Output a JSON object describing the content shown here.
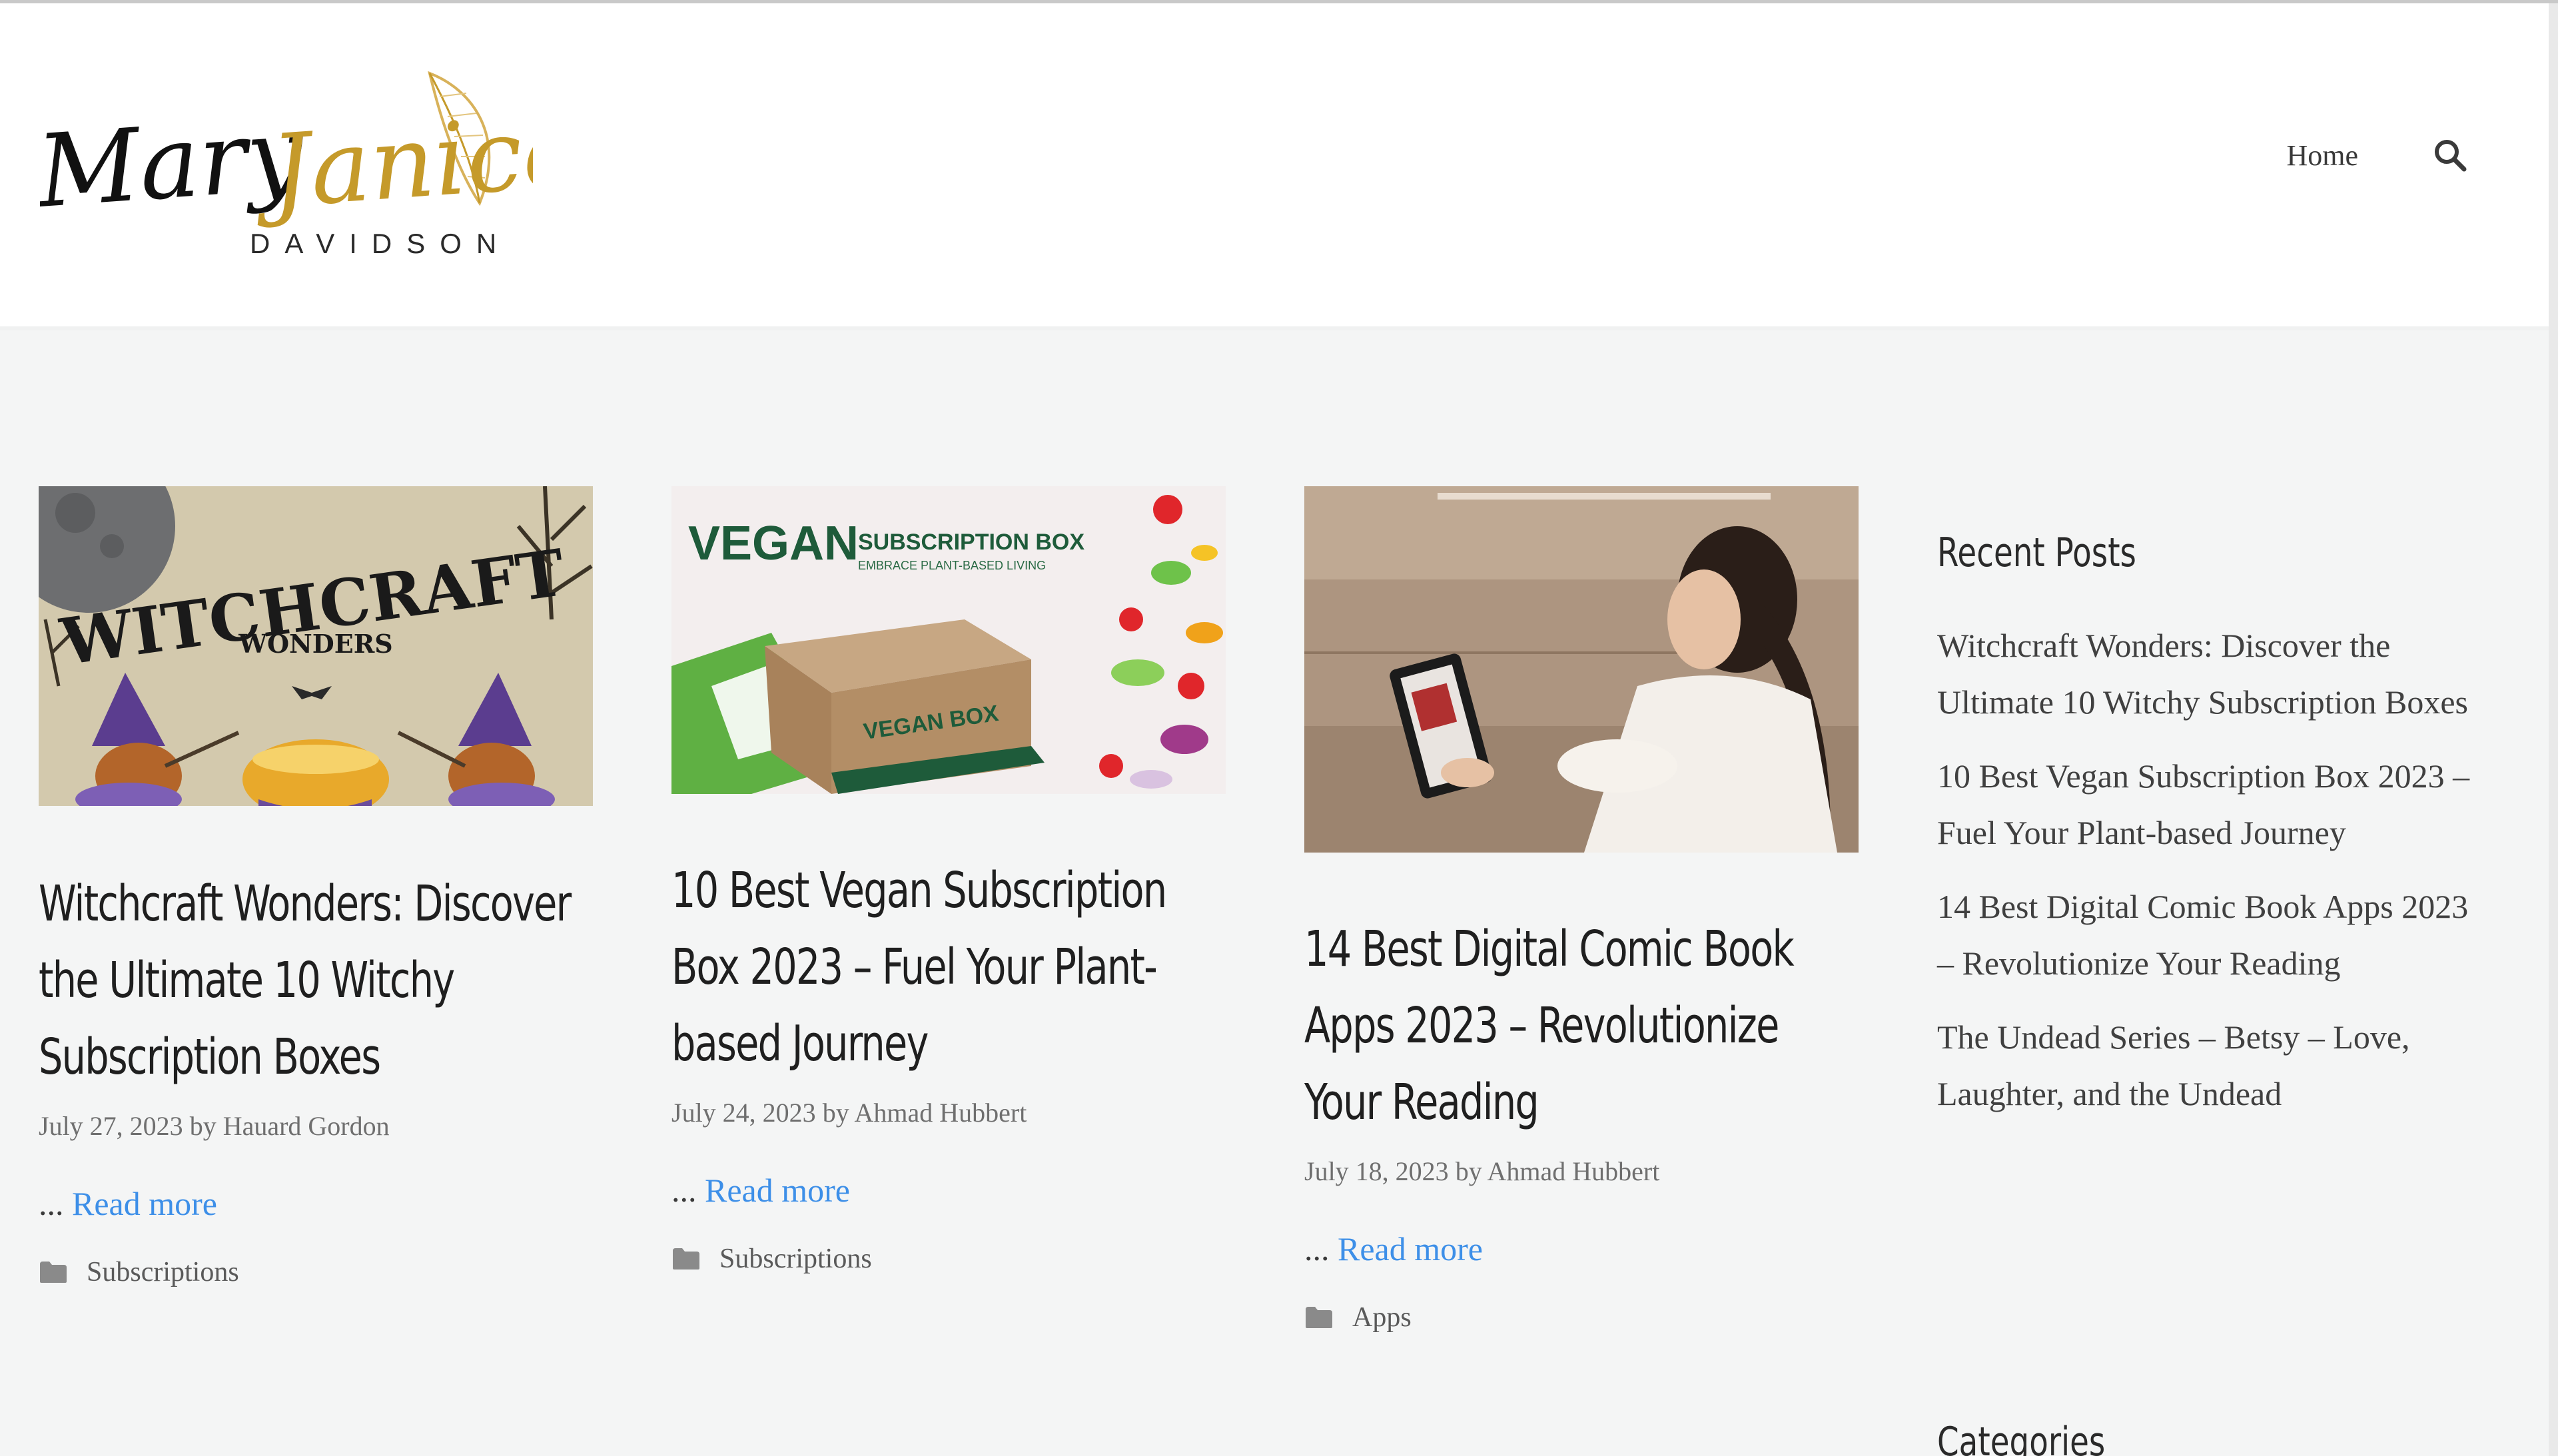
{
  "header": {
    "logo": {
      "first_name": "Mary",
      "middle_name": "Janice",
      "last_name": "DAVIDSON"
    },
    "nav": {
      "home_label": "Home",
      "search_icon": "search-icon"
    }
  },
  "posts": [
    {
      "title": "Witchcraft Wonders: Discover the Ultimate 10 Witchy Subscription Boxes",
      "date": "July 27, 2023",
      "by": "by",
      "author": "Hauard Gordon",
      "ellipsis": "...",
      "read_more": "Read more",
      "category": "Subscriptions",
      "thumbnail": {
        "heading": "WITCHCRAFT",
        "subheading": "WONDERS"
      }
    },
    {
      "title": "10 Best Vegan Subscription Box 2023 – Fuel Your Plant-based Journey",
      "date": "July 24, 2023",
      "by": "by",
      "author": "Ahmad Hubbert",
      "ellipsis": "...",
      "read_more": "Read more",
      "category": "Subscriptions",
      "thumbnail": {
        "heading": "VEGAN",
        "subheading": "SUBSCRIPTION BOX",
        "tagline": "EMBRACE PLANT-BASED LIVING",
        "box_label": "VEGAN BOX"
      }
    },
    {
      "title": "14 Best Digital Comic Book Apps 2023 – Revolutionize Your Reading",
      "date": "July 18, 2023",
      "by": "by",
      "author": "Ahmad Hubbert",
      "ellipsis": "...",
      "read_more": "Read more",
      "category": "Apps"
    }
  ],
  "sidebar": {
    "recent_posts_title": "Recent Posts",
    "recent_posts": [
      "Witchcraft Wonders: Discover the Ultimate 10 Witchy Subscription Boxes",
      "10 Best Vegan Subscription Box 2023 – Fuel Your Plant-based Journey",
      "14 Best Digital Comic Book Apps 2023 – Revolutionize Your Reading",
      "The Undead Series – Betsy – Love, Laughter, and the Undead"
    ],
    "categories_title": "Categories"
  },
  "colors": {
    "link": "#3d8fe8",
    "logo_gold": "#c59a2a",
    "text_dark": "#1f1f1f"
  }
}
